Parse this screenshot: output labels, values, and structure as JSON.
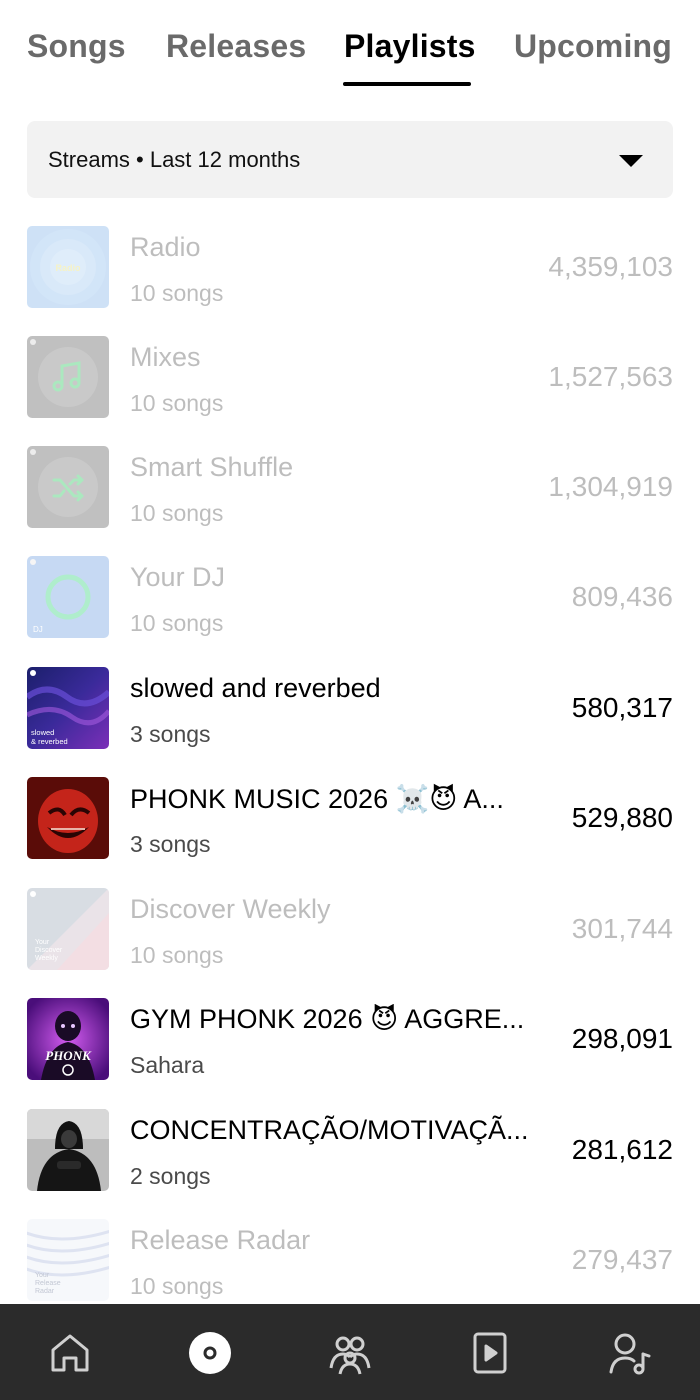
{
  "tabs": [
    {
      "label": "Songs",
      "active": false
    },
    {
      "label": "Releases",
      "active": false
    },
    {
      "label": "Playlists",
      "active": true
    },
    {
      "label": "Upcoming",
      "active": false
    }
  ],
  "filter": {
    "label": "Streams • Last 12 months",
    "icon": "caret-down-icon"
  },
  "playlists": [
    {
      "title": "Radio",
      "subtitle": "10 songs",
      "streams": "4,359,103",
      "dimmed": true,
      "thumb_text": "Radio"
    },
    {
      "title": "Mixes",
      "subtitle": "10 songs",
      "streams": "1,527,563",
      "dimmed": true,
      "icon": "music-note-icon"
    },
    {
      "title": "Smart Shuffle",
      "subtitle": "10 songs",
      "streams": "1,304,919",
      "dimmed": true,
      "icon": "shuffle-icon"
    },
    {
      "title": "Your DJ",
      "subtitle": "10 songs",
      "streams": "809,436",
      "dimmed": true,
      "thumb_text": "DJ"
    },
    {
      "title": "slowed and reverbed",
      "subtitle": "3 songs",
      "streams": "580,317",
      "dimmed": false,
      "thumb_text": "slowed & reverbed"
    },
    {
      "title": "PHONK MUSIC 2026 ☠️😈 A...",
      "subtitle": "3 songs",
      "streams": "529,880",
      "dimmed": false
    },
    {
      "title": "Discover Weekly",
      "subtitle": "10 songs",
      "streams": "301,744",
      "dimmed": true,
      "thumb_text": "Your Discover Weekly"
    },
    {
      "title": "GYM PHONK 2026 😈 AGGRE...",
      "subtitle": "Sahara",
      "streams": "298,091",
      "dimmed": false,
      "thumb_text": "PHONK"
    },
    {
      "title": "CONCENTRAÇÃO/MOTIVAÇÃ...",
      "subtitle": "2 songs",
      "streams": "281,612",
      "dimmed": false
    },
    {
      "title": "Release Radar",
      "subtitle": "10 songs",
      "streams": "279,437",
      "dimmed": true,
      "thumb_text": "Your Release Radar"
    }
  ],
  "nav": [
    {
      "name": "home-icon"
    },
    {
      "name": "music-disc-icon",
      "active": true
    },
    {
      "name": "audience-icon"
    },
    {
      "name": "campaigns-icon"
    },
    {
      "name": "artist-profile-icon"
    }
  ],
  "colors": {
    "active_tab": "#000000",
    "inactive_tab": "#6a6a6a",
    "navbar": "#2b2b2b",
    "filter_bg": "#f2f2f2"
  }
}
